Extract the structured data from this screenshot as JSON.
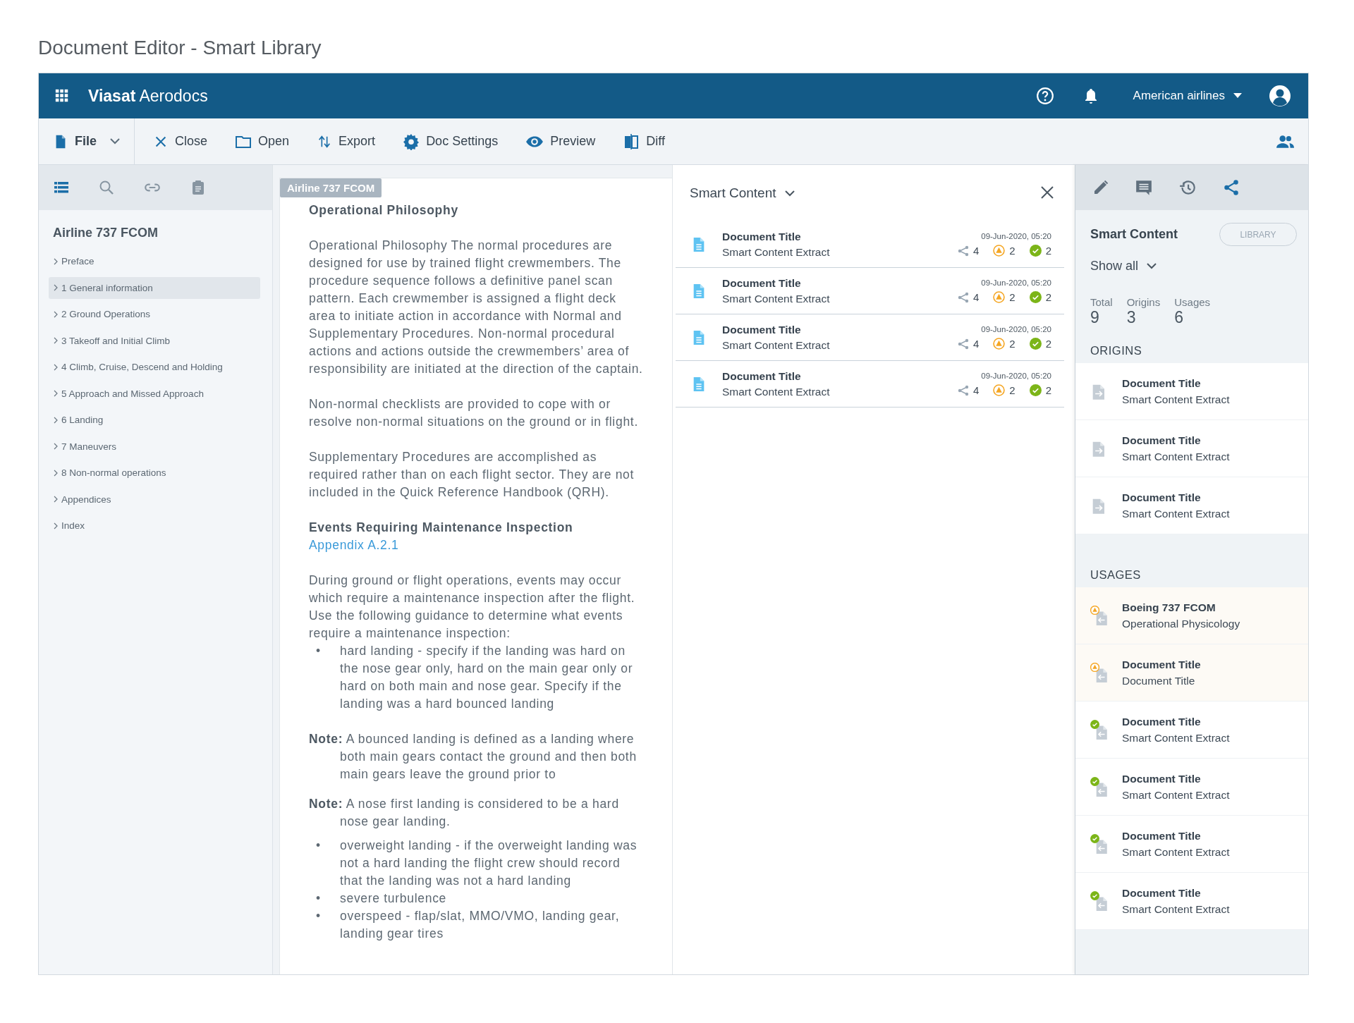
{
  "page_title": "Document Editor - Smart Library",
  "app_bar": {
    "brand": "**Viasat** Aerodocs",
    "account": "American airlines"
  },
  "toolbar": {
    "items": [
      {
        "kind": "file",
        "label": "File"
      },
      {
        "kind": "close",
        "label": "Close"
      },
      {
        "kind": "open",
        "label": "Open"
      },
      {
        "kind": "export",
        "label": "Export"
      },
      {
        "kind": "settings",
        "label": "Doc Settings"
      },
      {
        "kind": "preview",
        "label": "Preview"
      },
      {
        "kind": "diff",
        "label": "Diff"
      }
    ]
  },
  "sidebar": {
    "tabs": [
      {
        "kind": "list",
        "selected": true
      },
      {
        "kind": "search",
        "selected": false
      },
      {
        "kind": "link",
        "selected": false
      },
      {
        "kind": "clipboard",
        "selected": false
      }
    ],
    "title": "Airline 737 FCOM",
    "items": [
      {
        "label": "Preface",
        "selected": false
      },
      {
        "label": "1 General information",
        "selected": true
      },
      {
        "label": "2 Ground Operations",
        "selected": false
      },
      {
        "label": "3 Takeoff and Initial Climb",
        "selected": false
      },
      {
        "label": "4 Climb, Cruise, Descend and Holding",
        "selected": false
      },
      {
        "label": "5 Approach and Missed Approach",
        "selected": false
      },
      {
        "label": "6 Landing",
        "selected": false
      },
      {
        "label": "7 Maneuvers",
        "selected": false
      },
      {
        "label": "8 Non-normal operations",
        "selected": false
      },
      {
        "label": "Appendices",
        "selected": false
      },
      {
        "label": "Index",
        "selected": false
      }
    ]
  },
  "document": {
    "tab": "Airline 737 FCOM",
    "blocks": [
      {
        "kind": "heading",
        "text": "Operational Philosophy"
      },
      {
        "kind": "paragraph",
        "text": "Operational Philosophy The normal procedures are designed for use by trained flight crewmembers. The procedure sequence follows a definitive panel scan pattern. Each crewmember is assigned a flight deck area to initiate action in accordance with Normal and Supplementary Procedures. Non-normal procedural actions and actions outside the crewmembers’ area of responsibility are initiated at the direction of the captain."
      },
      {
        "kind": "paragraph",
        "text": "Non-normal checklists are provided to cope with or resolve non-normal situations on the ground or in flight."
      },
      {
        "kind": "paragraph",
        "text": "Supplementary Procedures are accomplished as required rather than on each flight sector. They are not included in the Quick Reference Handbook (QRH)."
      },
      {
        "kind": "heading",
        "text": "Events Requiring Maintenance Inspection"
      },
      {
        "kind": "link",
        "text": "Appendix A.2.1"
      },
      {
        "kind": "paragraph",
        "text": "During ground or flight operations, events may occur which require a maintenance inspection after the flight. Use the following guidance to determine what events require a maintenance inspection:"
      },
      {
        "kind": "bullets",
        "items": [
          {
            "bullet": "•",
            "text": "hard landing - specify if the landing was hard on the nose gear only, hard on the main gear only or hard on both main and nose gear. Specify if the landing was a hard bounced landing"
          }
        ]
      },
      {
        "kind": "note",
        "text": "**Note:** A bounced landing is defined as a landing where both main gears contact the ground and then both main gears leave the ground prior to"
      },
      {
        "kind": "note",
        "text": "**Note:** A nose first landing is considered to be a hard nose gear landing."
      },
      {
        "kind": "bullets",
        "items": [
          {
            "bullet": "•",
            "text": "overweight landing - if the overweight landing was not a hard landing the flight crew should record that the landing was not a hard landing"
          },
          {
            "bullet": "•",
            "text": "severe turbulence"
          },
          {
            "bullet": "•",
            "text": "overspeed - flap/slat, MMO/VMO, landing gear, landing gear tires"
          }
        ]
      }
    ]
  },
  "smart_content": {
    "title": "Smart Content",
    "rows": [
      {
        "title": "Document Title",
        "subtitle": "Smart Content Extract",
        "date": "09-Jun-2020, 05:20",
        "shares": "4",
        "warnings": "2",
        "approved": "2"
      },
      {
        "title": "Document Title",
        "subtitle": "Smart Content Extract",
        "date": "09-Jun-2020, 05:20",
        "shares": "4",
        "warnings": "2",
        "approved": "2"
      },
      {
        "title": "Document Title",
        "subtitle": "Smart Content Extract",
        "date": "09-Jun-2020, 05:20",
        "shares": "4",
        "warnings": "2",
        "approved": "2"
      },
      {
        "title": "Document Title",
        "subtitle": "Smart Content Extract",
        "date": "09-Jun-2020, 05:20",
        "shares": "4",
        "warnings": "2",
        "approved": "2"
      }
    ]
  },
  "right_panel": {
    "tabs": [
      {
        "kind": "edit",
        "selected": false
      },
      {
        "kind": "comments",
        "selected": false
      },
      {
        "kind": "history",
        "selected": false
      },
      {
        "kind": "share",
        "selected": true
      }
    ],
    "title": "Smart Content",
    "library_button": "LIBRARY",
    "filter": "Show all",
    "stats": [
      {
        "label": "Total",
        "value": "9"
      },
      {
        "label": "Origins",
        "value": "3"
      },
      {
        "label": "Usages",
        "value": "6"
      }
    ],
    "origins": {
      "heading": "ORIGINS",
      "items": [
        {
          "title": "Document Title",
          "subtitle": "Smart Content Extract"
        },
        {
          "title": "Document Title",
          "subtitle": "Smart Content Extract"
        },
        {
          "title": "Document Title",
          "subtitle": "Smart Content Extract"
        }
      ]
    },
    "usages": {
      "heading": "USAGES",
      "items": [
        {
          "title": "Boeing 737 FCOM",
          "subtitle": "Operational Physicology",
          "kind": "warning"
        },
        {
          "title": "Document Title",
          "subtitle": "Document Title",
          "kind": "warning"
        },
        {
          "title": "Document Title",
          "subtitle": "Smart Content Extract",
          "kind": "ok"
        },
        {
          "title": "Document Title",
          "subtitle": "Smart Content Extract",
          "kind": "ok"
        },
        {
          "title": "Document Title",
          "subtitle": "Smart Content Extract",
          "kind": "ok"
        },
        {
          "title": "Document Title",
          "subtitle": "Smart Content Extract",
          "kind": "ok"
        }
      ]
    }
  }
}
